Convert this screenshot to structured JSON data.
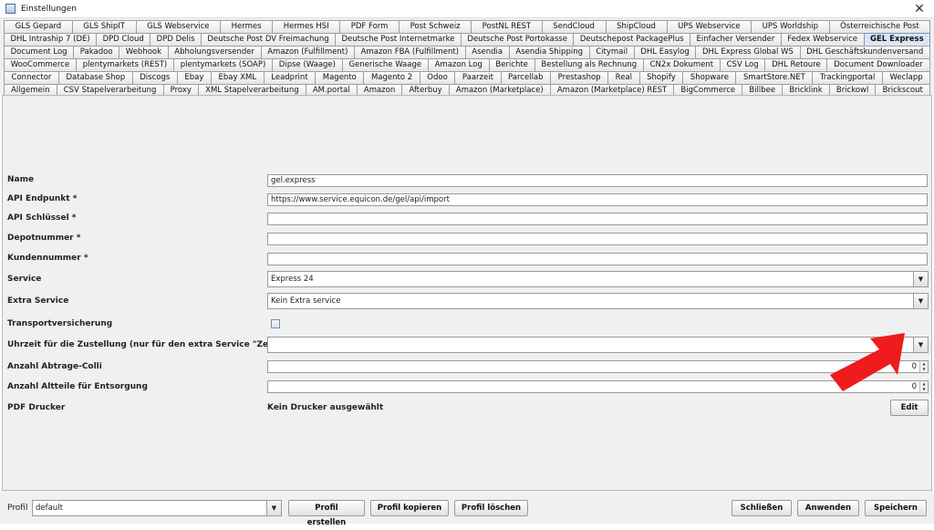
{
  "window": {
    "title": "Einstellungen",
    "close_glyph": "✕"
  },
  "tab_rows": [
    [
      "GLS Gepard",
      "GLS ShipIT",
      "GLS Webservice",
      "Hermes",
      "Hermes HSI",
      "PDF Form",
      "Post Schweiz",
      "PostNL REST",
      "SendCloud",
      "ShipCloud",
      "UPS Webservice",
      "UPS Worldship",
      "Österreichische Post"
    ],
    [
      "DHL Intraship 7 (DE)",
      "DPD Cloud",
      "DPD Delis",
      "Deutsche Post DV Freimachung",
      "Deutsche Post Internetmarke",
      "Deutsche Post Portokasse",
      "Deutschepost PackagePlus",
      "Einfacher Versender",
      "Fedex Webservice",
      "GEL Express"
    ],
    [
      "Document Log",
      "Pakadoo",
      "Webhook",
      "Abholungsversender",
      "Amazon (Fulfillment)",
      "Amazon FBA (Fulfillment)",
      "Asendia",
      "Asendia Shipping",
      "Citymail",
      "DHL Easylog",
      "DHL Express Global WS",
      "DHL Geschäftskundenversand"
    ],
    [
      "WooCommerce",
      "plentymarkets (REST)",
      "plentymarkets (SOAP)",
      "Dipse (Waage)",
      "Generische Waage",
      "Amazon Log",
      "Berichte",
      "Bestellung als Rechnung",
      "CN2x Dokument",
      "CSV Log",
      "DHL Retoure",
      "Document Downloader"
    ],
    [
      "Connector",
      "Database Shop",
      "Discogs",
      "Ebay",
      "Ebay XML",
      "Leadprint",
      "Magento",
      "Magento 2",
      "Odoo",
      "Paarzeit",
      "Parcellab",
      "Prestashop",
      "Real",
      "Shopify",
      "Shopware",
      "SmartStore.NET",
      "Trackingportal",
      "Weclapp"
    ],
    [
      "Allgemein",
      "CSV Stapelverarbeitung",
      "Proxy",
      "XML Stapelverarbeitung",
      "AM.portal",
      "Amazon",
      "Afterbuy",
      "Amazon (Marketplace)",
      "Amazon (Marketplace) REST",
      "BigCommerce",
      "Billbee",
      "Bricklink",
      "Brickowl",
      "Brickscout"
    ]
  ],
  "active_tab": "GEL Express",
  "form": {
    "name": {
      "label": "Name",
      "value": "gel.express"
    },
    "api_endpoint": {
      "label": "API Endpunkt *",
      "value": "https://www.service.equicon.de/gel/api/import"
    },
    "api_key": {
      "label": "API Schlüssel *",
      "value": ""
    },
    "depot": {
      "label": "Depotnummer *",
      "value": ""
    },
    "customer": {
      "label": "Kundennummer *",
      "value": ""
    },
    "service": {
      "label": "Service",
      "value": "Express 24"
    },
    "extra_service": {
      "label": "Extra Service",
      "value": "Kein Extra service"
    },
    "insurance": {
      "label": "Transportversicherung",
      "checked": false
    },
    "delivery_time": {
      "label": "Uhrzeit für die Zustellung (nur für den extra Service \"Zeit festlegen\")",
      "value": ""
    },
    "colli": {
      "label": "Anzahl Abtrage-Colli",
      "value": "0"
    },
    "old_parts": {
      "label": "Anzahl Altteile für Entsorgung",
      "value": "0"
    },
    "pdf_printer": {
      "label": "PDF Drucker",
      "value": "Kein Drucker ausgewählt",
      "edit_label": "Edit"
    }
  },
  "bottom": {
    "profile_label": "Profil",
    "profile_value": "default",
    "create_label": "Profil erstellen",
    "copy_label": "Profil kopieren",
    "delete_label": "Profil löschen",
    "close_label": "Schließen",
    "apply_label": "Anwenden",
    "save_label": "Speichern"
  },
  "icons": {
    "dropdown": "▼",
    "spin_up": "▲",
    "spin_down": "▼"
  },
  "colors": {
    "annotation_arrow": "#ee1c1c",
    "active_tab": "#dbe6f4"
  }
}
